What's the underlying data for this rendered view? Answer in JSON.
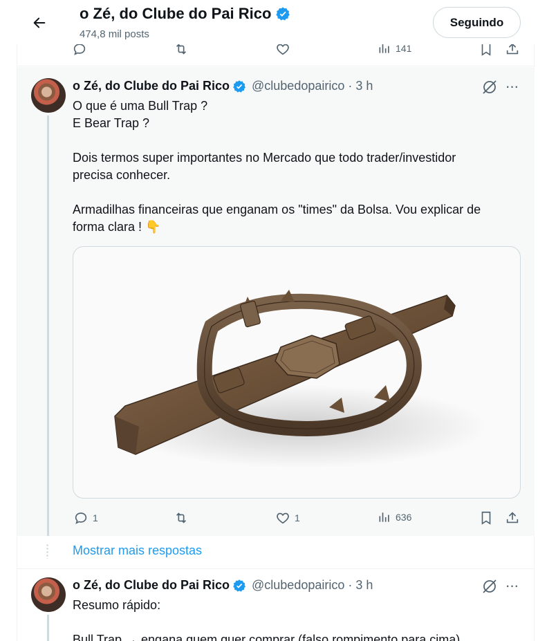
{
  "header": {
    "title": "o Zé, do Clube do Pai Rico",
    "posts": "474,8 mil posts",
    "follow_label": "Seguindo"
  },
  "top_actions": {
    "views": "141"
  },
  "tweet1": {
    "name": "o Zé, do Clube do Pai Rico",
    "handle_time": "@clubedopairico · 3 h",
    "lines": [
      "O que é uma Bull Trap ?",
      "E Bear Trap ?",
      "",
      "Dois termos super importantes no Mercado que todo trader/investidor",
      "precisa conhecer.",
      "",
      "Armadilhas financeiras que enganam os \"times\" da Bolsa. Vou explicar de",
      "forma clara ! 👇"
    ],
    "replies": "1",
    "likes": "1",
    "views": "636"
  },
  "show_more_label": "Mostrar mais respostas",
  "tweet2": {
    "name": "o Zé, do Clube do Pai Rico",
    "handle_time": "@clubedopairico · 3 h",
    "lines": [
      "Resumo rápido:",
      "",
      "Bull Trap → engana quem quer comprar (falso rompimento para cima)"
    ]
  },
  "colors": {
    "accent": "#1d9bf0",
    "muted": "#536471",
    "text": "#0f1419"
  }
}
